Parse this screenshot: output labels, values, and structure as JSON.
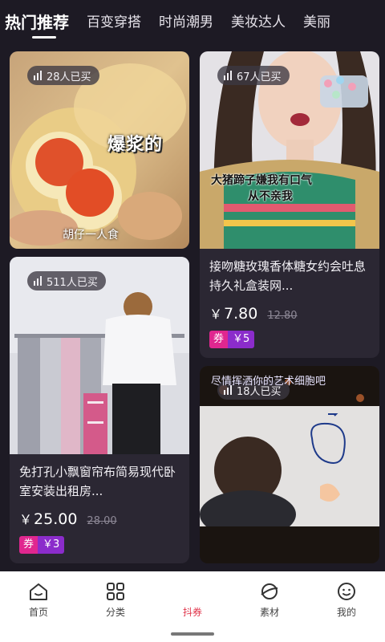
{
  "tabs": [
    "热门推荐",
    "百变穿搭",
    "时尚潮男",
    "美妆达人",
    "美丽"
  ],
  "cards": [
    {
      "buyers": "28人已买",
      "overlay_big": "爆浆的",
      "overlay_author": "胡仔一人食"
    },
    {
      "buyers": "67人已买",
      "overlay_caption_1": "大猪蹄子嫌我有口气",
      "overlay_caption_2": "从不亲我",
      "title": "接吻糖玫瑰香体糖女约会吐息持久礼盒装网...",
      "price": "7.80",
      "original_price": "12.80",
      "coupon_label": "券",
      "coupon_value": "￥5"
    },
    {
      "buyers": "511人已买",
      "title": "免打孔小飘窗帘布简易现代卧室安装出租房...",
      "price": "25.00",
      "original_price": "28.00",
      "coupon_label": "券",
      "coupon_value": "￥3"
    },
    {
      "buyers": "18人已买",
      "overlay_top": "尽情挥洒你的艺术细胞吧"
    }
  ],
  "currency": "￥",
  "nav": [
    {
      "label": "首页",
      "icon": "home-icon"
    },
    {
      "label": "分类",
      "icon": "category-icon"
    },
    {
      "label": "抖券",
      "icon": "coupon-icon"
    },
    {
      "label": "素材",
      "icon": "planet-icon"
    },
    {
      "label": "我的",
      "icon": "profile-icon"
    }
  ],
  "colors": {
    "bg": "#1d1a24",
    "card": "#2b2733",
    "active_nav": "#e0344a",
    "coupon_pink": "#e0278f",
    "coupon_purple": "#8b2ccb"
  }
}
